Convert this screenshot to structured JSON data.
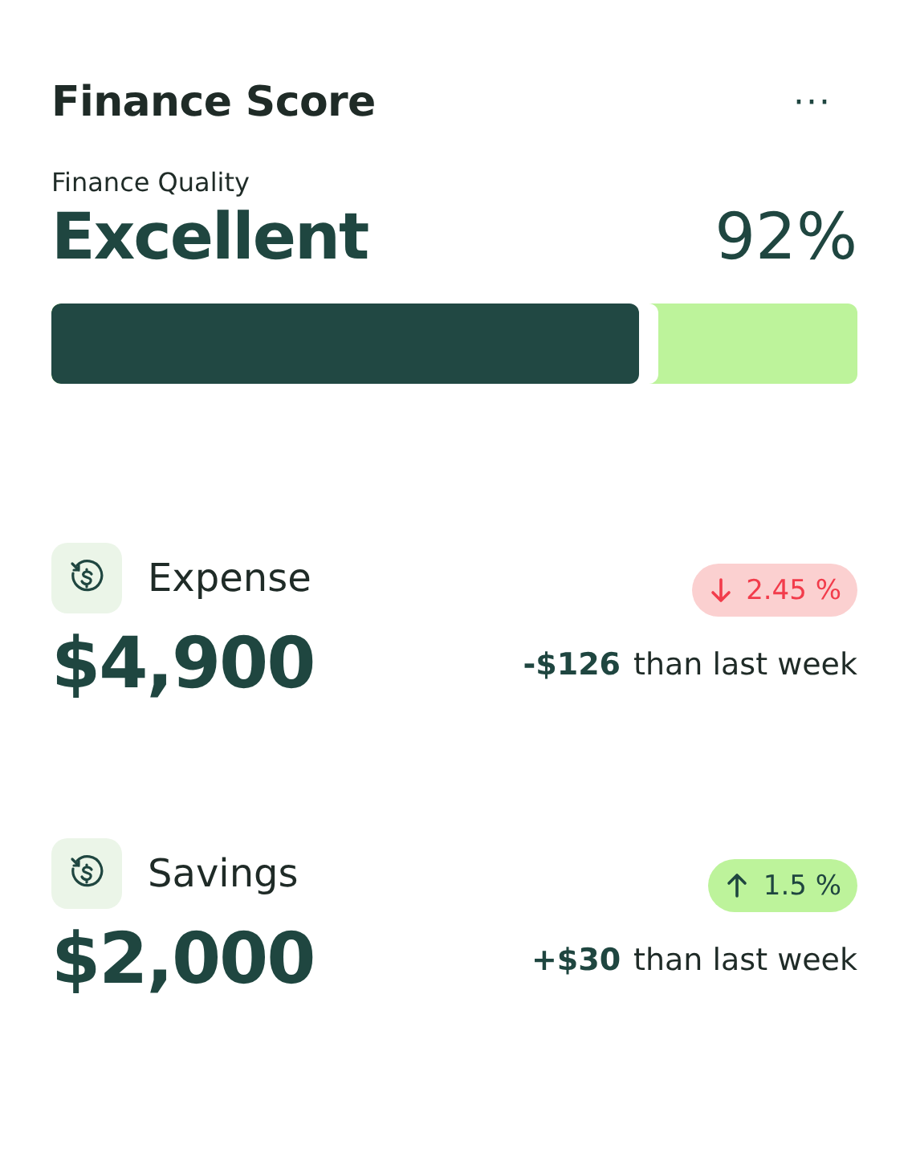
{
  "card": {
    "title": "Finance Score",
    "menu": "···"
  },
  "quality": {
    "label": "Finance Quality",
    "rating": "Excellent",
    "percent": "92%",
    "level": 0.73
  },
  "metrics": [
    {
      "label": "Expense",
      "amount": "$4,900",
      "change": "2.45 %",
      "kind": "down",
      "delta": "-$126",
      "comparison": "than last week"
    },
    {
      "label": "Savings",
      "amount": "$2,000",
      "change": "1.5 %",
      "kind": "up",
      "delta": "+$30",
      "comparison": "than last week"
    }
  ]
}
